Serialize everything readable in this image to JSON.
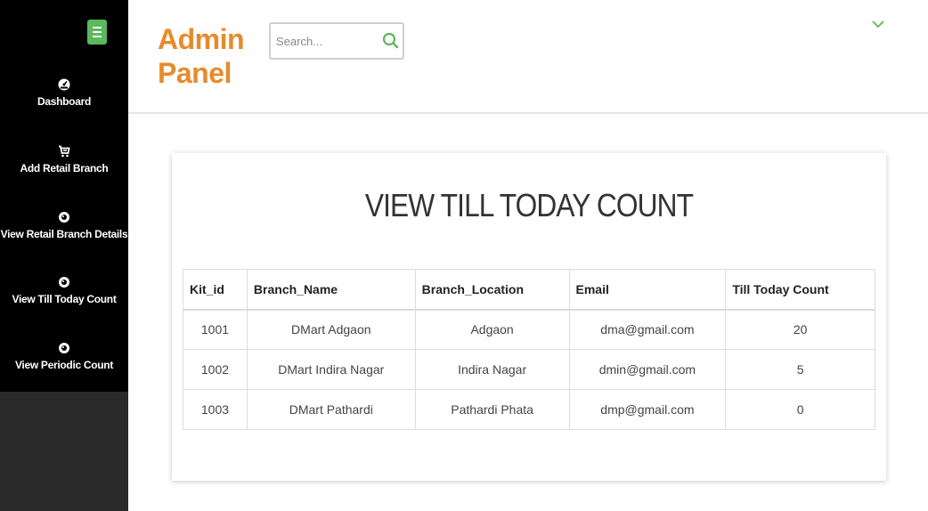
{
  "sidebar": {
    "items": [
      {
        "icon": "dashboard-icon",
        "label": "Dashboard"
      },
      {
        "icon": "cart-icon",
        "label": "Add Retail Branch"
      },
      {
        "icon": "eye-icon",
        "label": "View Retail Branch Details"
      },
      {
        "icon": "eye-icon",
        "label": "View Till Today Count"
      },
      {
        "icon": "eye-icon",
        "label": "View Periodic Count"
      }
    ]
  },
  "header": {
    "brand_line1": "Admin",
    "brand_line2": "Panel",
    "search_placeholder": "Search..."
  },
  "main": {
    "title": "VIEW TILL TODAY COUNT",
    "table": {
      "columns": [
        "Kit_id",
        "Branch_Name",
        "Branch_Location",
        "Email",
        "Till Today Count"
      ],
      "rows": [
        [
          "1001",
          "DMart Adgaon",
          "Adgaon",
          "dma@gmail.com",
          "20"
        ],
        [
          "1002",
          "DMart Indira Nagar",
          "Indira Nagar",
          "dmin@gmail.com",
          "5"
        ],
        [
          "1003",
          "DMart Pathardi",
          "Pathardi Phata",
          "dmp@gmail.com",
          "0"
        ]
      ]
    }
  },
  "colors": {
    "brand": "#e88a2c",
    "accent_green": "#5cb85c",
    "sidebar_bg": "#000000"
  }
}
